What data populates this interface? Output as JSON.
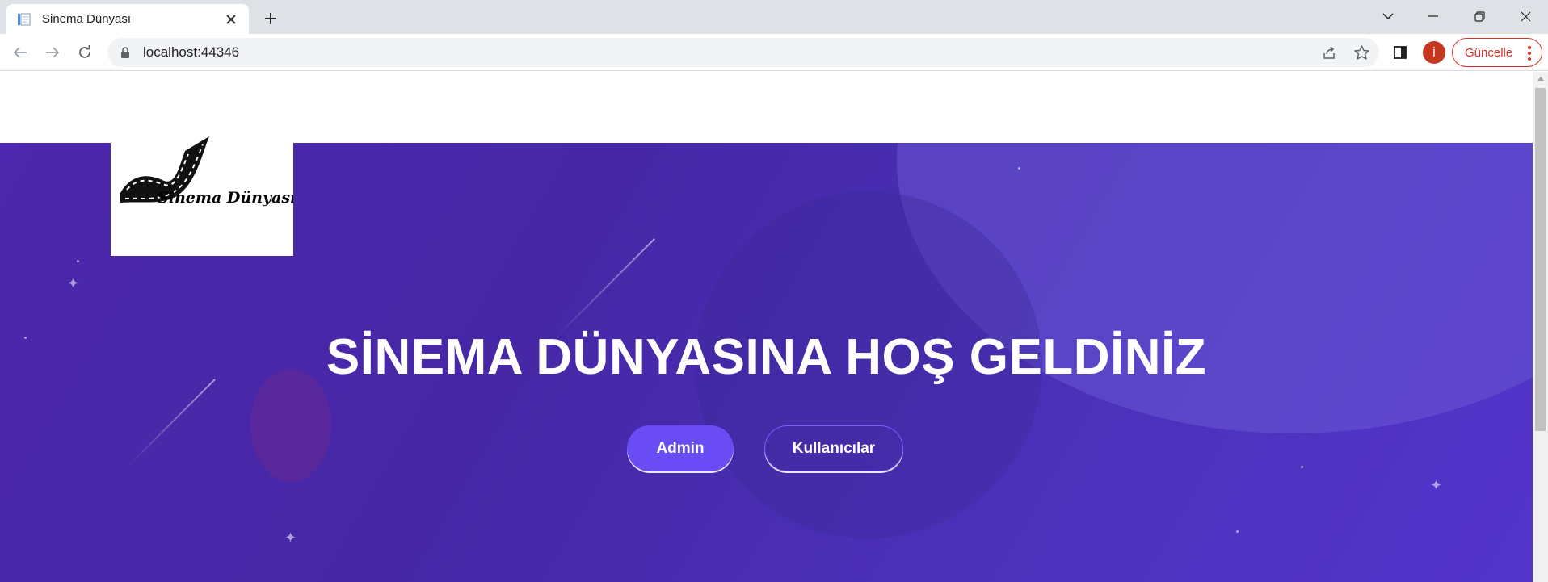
{
  "browser": {
    "tab_title": "Sinema Dünyası",
    "url": "localhost:44346",
    "profile_initial": "İ",
    "update_label": "Güncelle"
  },
  "page": {
    "logo_text": "Sinema Dünyası",
    "hero_title": "SİNEMA DÜNYASINA HOŞ GELDİNİZ",
    "buttons": {
      "admin": "Admin",
      "users": "Kullanıcılar"
    }
  },
  "colors": {
    "hero_background": "#4a2db0",
    "primary_button": "#6a4cf5",
    "update_accent": "#d93025",
    "avatar": "#c5381f"
  },
  "icons": [
    "document-icon",
    "close-icon",
    "plus-icon",
    "chevron-down-icon",
    "minimize-icon",
    "restore-icon",
    "window-close-icon",
    "back-arrow-icon",
    "forward-arrow-icon",
    "reload-icon",
    "lock-icon",
    "share-icon",
    "star-icon",
    "side-panel-icon",
    "more-vertical-icon",
    "film-strip-icon"
  ]
}
